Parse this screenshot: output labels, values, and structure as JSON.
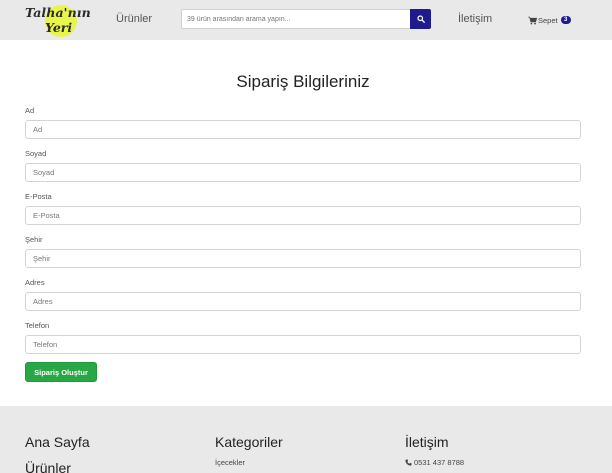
{
  "header": {
    "logo_line1": "Talha'nın",
    "logo_line2": "Yeri",
    "nav_products": "Ürünler",
    "search_placeholder": "39 ürün arasından arama yapın...",
    "search_icon": "search-icon",
    "nav_contact": "İletişim",
    "cart_label": "Sepet",
    "cart_count": "3",
    "cart_icon": "cart-icon"
  },
  "form": {
    "title": "Sipariş Bilgileriniz",
    "fields": [
      {
        "label": "Ad",
        "placeholder": "Ad"
      },
      {
        "label": "Soyad",
        "placeholder": "Soyad"
      },
      {
        "label": "E-Posta",
        "placeholder": "E-Posta"
      },
      {
        "label": "Şehir",
        "placeholder": "Şehir"
      },
      {
        "label": "Adres",
        "placeholder": "Adres"
      },
      {
        "label": "Telefon",
        "placeholder": "Telefon"
      }
    ],
    "submit_label": "Sipariş Oluştur"
  },
  "footer": {
    "col1_links": [
      "Ana Sayfa",
      "Ürünler"
    ],
    "col2_heading": "Kategoriler",
    "col2_items": [
      "İçecekler"
    ],
    "col3_heading": "İletişim",
    "phone": "0531 437 8788",
    "phone_icon": "phone-icon"
  },
  "colors": {
    "header_bg": "#e9e9e9",
    "accent": "#1f1a8e",
    "submit": "#28a745",
    "logo_circle": "#e8f54a"
  }
}
